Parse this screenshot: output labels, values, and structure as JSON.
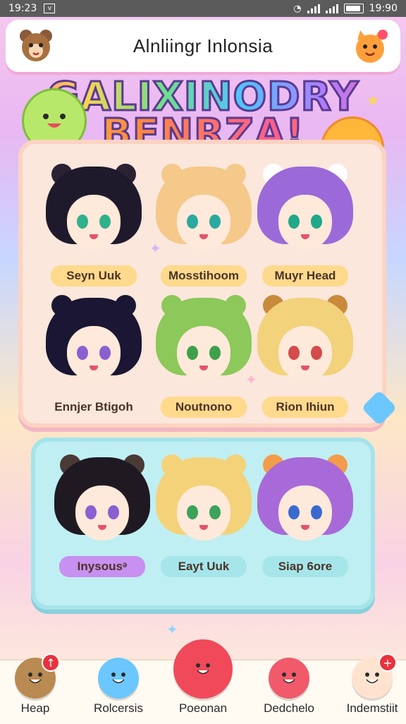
{
  "status_bar": {
    "time_left": "19:23",
    "time_right": "19:90",
    "notification_icon": "download-notification-icon"
  },
  "header": {
    "title": "Alnliingr Inlonsia",
    "left_icon": "bear-avatar-icon",
    "right_icon": "orange-cat-icon"
  },
  "logo": {
    "line1": "GALIXINODRY",
    "line2": "BENRZA!"
  },
  "colors": {
    "accent_pink": "#f0a9d7",
    "panel_peach": "#fbe7dc",
    "panel_aqua": "#bfeff2",
    "badge_red": "#e8323e"
  },
  "characters_panel1": [
    {
      "name": "Seyn Uuk",
      "hair": "#1f1a2b",
      "eyes": "#2fb28b",
      "label_bg": "#ffd98c",
      "ears": "#2a2233"
    },
    {
      "name": "Mosstihoom",
      "hair": "#f5c98a",
      "eyes": "#2aa9a0",
      "label_bg": "#ffd98c",
      "ears": "#f5c98a"
    },
    {
      "name": "Muyr Head",
      "hair": "#9c6ad8",
      "eyes": "#1fa889",
      "label_bg": "#ffd98c",
      "ears": "#ffffff"
    },
    {
      "name": "Ennjer Btigoh",
      "hair": "#1a1633",
      "eyes": "#8b5fd0",
      "label_bg": "#fbe7dc",
      "ears": "#1a1633"
    },
    {
      "name": "Noutnono",
      "hair": "#8cc85a",
      "eyes": "#3da04a",
      "label_bg": "#ffd98c",
      "ears": "#8cc85a"
    },
    {
      "name": "Rion Ihiun",
      "hair": "#f2d27a",
      "eyes": "#d54a4a",
      "label_bg": "#ffd98c",
      "ears": "#c98a3a"
    }
  ],
  "characters_panel2": [
    {
      "name": "Inysousᵊ",
      "hair": "#1f1a22",
      "eyes": "#8b5fd0",
      "label_bg": "#c890f0",
      "ears": "#4a3a35"
    },
    {
      "name": "Eayt Uuk",
      "hair": "#f4d27a",
      "eyes": "#3aa35a",
      "label_bg": "#a6e6ea",
      "ears": "#f4d27a"
    },
    {
      "name": "Siap 6ore",
      "hair": "#a86ad8",
      "eyes": "#3a6ad0",
      "label_bg": "#a6e6ea",
      "ears": "#f39c4a"
    }
  ],
  "bottom_nav": [
    {
      "label": "Heap",
      "icon": "brown-box-icon",
      "badge": "↑",
      "color": "#b98a52"
    },
    {
      "label": "Rolcersis",
      "icon": "blue-blob-icon",
      "badge": "",
      "color": "#6cc7ff"
    },
    {
      "label": "Poeonan",
      "icon": "red-smile-ball-icon",
      "badge": "",
      "color": "#f04a5a"
    },
    {
      "label": "Dedchelo",
      "icon": "red-creature-icon",
      "badge": "",
      "color": "#f05a6a"
    },
    {
      "label": "Indemstiit",
      "icon": "smiley-face-icon",
      "badge": "+",
      "color": "#ffe3cf"
    }
  ]
}
